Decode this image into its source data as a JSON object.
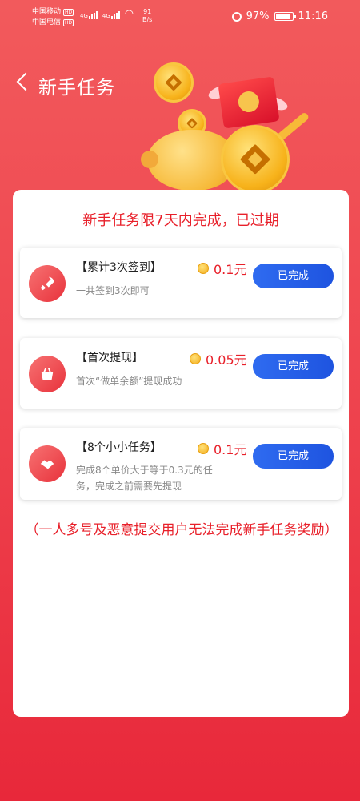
{
  "status_bar": {
    "carrier1": "中国移动",
    "carrier2": "中国电信",
    "hd": "HD",
    "net1": "4G",
    "net2": "4G",
    "speed_value": "91",
    "speed_unit": "B/s",
    "battery": "97%",
    "time": "11:16"
  },
  "header": {
    "title": "新手任务"
  },
  "card": {
    "notice": "新手任务限7天内完成，已过期",
    "tasks": [
      {
        "name": "【累计3次签到】",
        "reward": "0.1元",
        "desc": "一共签到3次即可",
        "button": "已完成",
        "icon": "rocket-icon"
      },
      {
        "name": "【首次提现】",
        "reward": "0.05元",
        "desc": "首次“做单余额”提现成功",
        "button": "已完成",
        "icon": "bag-icon"
      },
      {
        "name": "【8个小小任务】",
        "reward": "0.1元",
        "desc_line1": "完成8个单价大于等于0.3元的任",
        "desc_line2": "务，完成之前需要先提现",
        "button": "已完成",
        "icon": "handshake-icon"
      }
    ],
    "warning": "（一人多号及恶意提交用户无法完成新手任务奖励）"
  },
  "colors": {
    "background": "#ef4650",
    "accent_red": "#e8202a",
    "button_blue": "#2f6bf0"
  }
}
